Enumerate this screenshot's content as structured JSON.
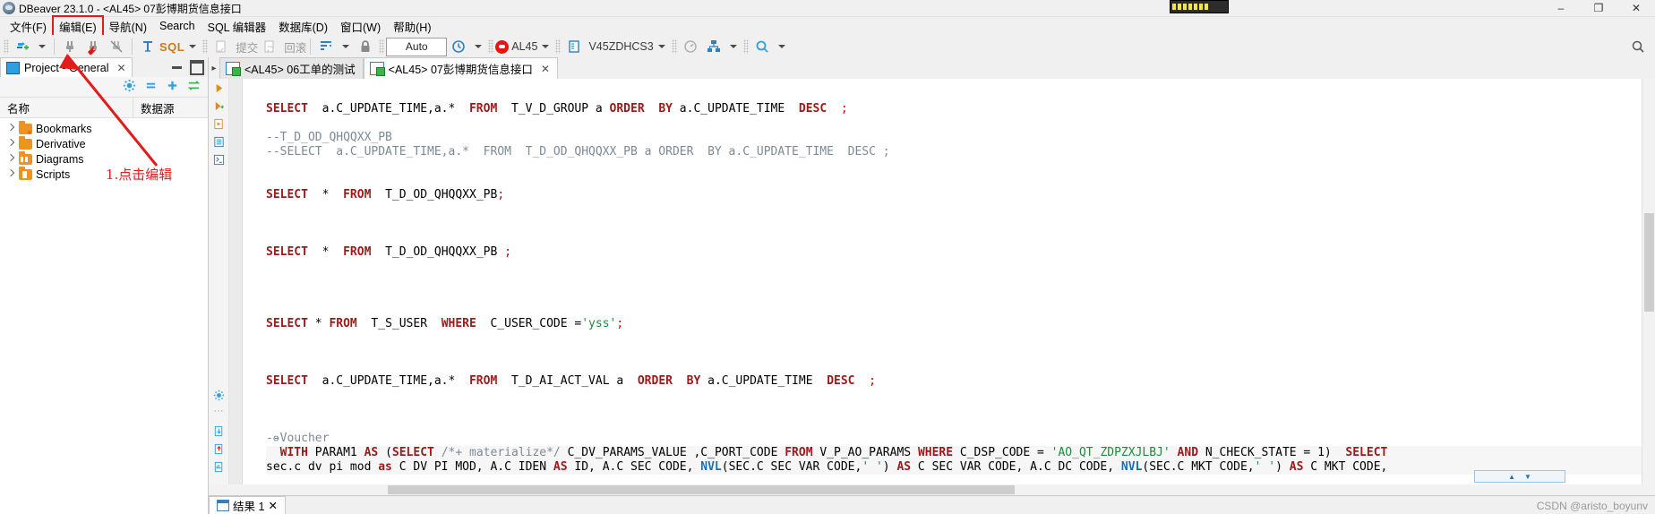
{
  "window": {
    "title": "DBeaver 23.1.0 - <AL45> 07彭博期货信息接口",
    "app_icon": "dbeaver-icon",
    "minimize": "–",
    "maximize": "❐",
    "close": "✕"
  },
  "menubar": {
    "items": [
      {
        "label": "文件(F)",
        "boxed": false
      },
      {
        "label": "编辑(E)",
        "boxed": true
      },
      {
        "label": "导航(N)",
        "boxed": false
      },
      {
        "label": "Search",
        "boxed": false
      },
      {
        "label": "SQL 编辑器",
        "boxed": false
      },
      {
        "label": "数据库(D)",
        "boxed": false
      },
      {
        "label": "窗口(W)",
        "boxed": false
      },
      {
        "label": "帮助(H)",
        "boxed": false
      }
    ]
  },
  "toolbar": {
    "new_connection": "new-connection-icon",
    "connect": "connect-icon",
    "disconnect": "disconnect-icon",
    "invalidate": "invalidate-icon",
    "sql_label": "SQL",
    "commit_label": "提交",
    "rollback_label": "回滚",
    "txn_mode_icon": "transaction-mode-icon",
    "lock_icon": "lock-icon",
    "auto_value": "Auto",
    "history_icon": "history-icon",
    "connection_name": "AL45",
    "database_name": "V45ZDHCS3",
    "dashboard_icon": "dashboard-icon",
    "schema_icon": "schema-icon",
    "search_icon": "search-icon",
    "global_search_icon": "global-search-icon"
  },
  "left_panel": {
    "tab_label": "Project - General",
    "tab_close": "✕",
    "tab_icon": "project-icon",
    "minimize_icon": "minimize-icon",
    "maximize_icon": "maximize-icon",
    "tools": [
      "gear-icon",
      "collapse-all-icon",
      "add-icon",
      "link-icon"
    ],
    "col_name": "名称",
    "col_datasource": "数据源",
    "tree": [
      {
        "label": "Bookmarks",
        "icon": "bookmark-folder-icon"
      },
      {
        "label": "Derivative",
        "icon": "folder-icon"
      },
      {
        "label": "Diagrams",
        "icon": "diagram-folder-icon"
      },
      {
        "label": "Scripts",
        "icon": "script-folder-icon"
      }
    ]
  },
  "annotation": {
    "text": "1.点击编辑",
    "color": "#e21b1b"
  },
  "editor": {
    "scroll_left_icon": "▸",
    "tabs": [
      {
        "label": "<AL45> 06工单的测试",
        "active": false,
        "close": "",
        "icon": "sql-file-icon"
      },
      {
        "label": "<AL45> 07彭博期货信息接口",
        "active": true,
        "close": "✕",
        "icon": "sql-file-icon"
      }
    ],
    "gutter_icons": [
      "execute-statement-icon",
      "execute-script-icon",
      "execute-to-file-icon",
      "execute-grid-icon",
      "execute-console-icon",
      "gear-icon",
      "more-icon",
      "export-icon",
      "import-icon",
      "report-icon"
    ],
    "fold_marker": "⊖",
    "lines": [
      {
        "blank": true
      },
      {
        "tokens": [
          {
            "t": "SELECT",
            "c": "kw"
          },
          {
            "t": "  a.C_UPDATE_TIME,a.*  ",
            "c": "plain"
          },
          {
            "t": "FROM",
            "c": "kw"
          },
          {
            "t": "  T_V_D_GROUP a ",
            "c": "plain"
          },
          {
            "t": "ORDER",
            "c": "kw"
          },
          {
            "t": "  ",
            "c": "plain"
          },
          {
            "t": "BY",
            "c": "kw"
          },
          {
            "t": " a.C_UPDATE_TIME  ",
            "c": "plain"
          },
          {
            "t": "DESC",
            "c": "kw"
          },
          {
            "t": "  ;",
            "c": "pun"
          }
        ]
      },
      {
        "blank": true
      },
      {
        "tokens": [
          {
            "t": "--T_D_OD_QHQQXX_PB",
            "c": "cm"
          }
        ]
      },
      {
        "tokens": [
          {
            "t": "--SELECT  a.C_UPDATE_TIME,a.*  FROM  T_D_OD_QHQQXX_PB a ORDER  BY a.C_UPDATE_TIME  DESC ;",
            "c": "cm"
          }
        ]
      },
      {
        "blank": true
      },
      {
        "blank": true
      },
      {
        "tokens": [
          {
            "t": "SELECT",
            "c": "kw"
          },
          {
            "t": "  *  ",
            "c": "plain"
          },
          {
            "t": "FROM",
            "c": "kw"
          },
          {
            "t": "  T_D_OD_QHQQXX_PB",
            "c": "plain"
          },
          {
            "t": ";",
            "c": "pun"
          }
        ]
      },
      {
        "blank": true
      },
      {
        "blank": true
      },
      {
        "blank": true
      },
      {
        "tokens": [
          {
            "t": "SELECT",
            "c": "kw"
          },
          {
            "t": "  *  ",
            "c": "plain"
          },
          {
            "t": "FROM",
            "c": "kw"
          },
          {
            "t": "  T_D_OD_QHQQXX_PB ",
            "c": "plain"
          },
          {
            "t": ";",
            "c": "pun"
          }
        ]
      },
      {
        "blank": true
      },
      {
        "blank": true
      },
      {
        "blank": true
      },
      {
        "blank": true
      },
      {
        "tokens": [
          {
            "t": "SELECT",
            "c": "kw"
          },
          {
            "t": " * ",
            "c": "plain"
          },
          {
            "t": "FROM",
            "c": "kw"
          },
          {
            "t": "  T_S_USER  ",
            "c": "plain"
          },
          {
            "t": "WHERE",
            "c": "kw"
          },
          {
            "t": "  C_USER_CODE =",
            "c": "plain"
          },
          {
            "t": "'yss'",
            "c": "str"
          },
          {
            "t": ";",
            "c": "pun"
          }
        ]
      },
      {
        "blank": true
      },
      {
        "blank": true
      },
      {
        "blank": true
      },
      {
        "tokens": [
          {
            "t": "SELECT",
            "c": "kw"
          },
          {
            "t": "  a.C_UPDATE_TIME,a.*  ",
            "c": "plain"
          },
          {
            "t": "FROM",
            "c": "kw"
          },
          {
            "t": "  T_D_AI_ACT_VAL a  ",
            "c": "plain"
          },
          {
            "t": "ORDER",
            "c": "kw"
          },
          {
            "t": "  ",
            "c": "plain"
          },
          {
            "t": "BY",
            "c": "kw"
          },
          {
            "t": " a.C_UPDATE_TIME  ",
            "c": "plain"
          },
          {
            "t": "DESC",
            "c": "kw"
          },
          {
            "t": "  ;",
            "c": "pun"
          }
        ]
      },
      {
        "blank": true
      },
      {
        "blank": true
      },
      {
        "blank": true
      },
      {
        "tokens": [
          {
            "t": "--Voucher",
            "c": "cm"
          }
        ],
        "fold": true
      },
      {
        "tokens": [
          {
            "t": "  WITH",
            "c": "kw"
          },
          {
            "t": " PARAM1 ",
            "c": "plain"
          },
          {
            "t": "AS",
            "c": "kw"
          },
          {
            "t": " (",
            "c": "plain"
          },
          {
            "t": "SELECT",
            "c": "kw"
          },
          {
            "t": " ",
            "c": "plain"
          },
          {
            "t": "/*+ materialize*/",
            "c": "cm"
          },
          {
            "t": " C_DV_PARAMS_VALUE ,C_PORT_CODE ",
            "c": "plain"
          },
          {
            "t": "FROM",
            "c": "kw"
          },
          {
            "t": " V_P_AO_PARAMS ",
            "c": "plain"
          },
          {
            "t": "WHERE",
            "c": "kw"
          },
          {
            "t": " C_DSP_CODE = ",
            "c": "plain"
          },
          {
            "t": "'AO_QT_ZDPZXJLBJ'",
            "c": "str"
          },
          {
            "t": " ",
            "c": "plain"
          },
          {
            "t": "AND",
            "c": "kw"
          },
          {
            "t": " N_CHECK_STATE = ",
            "c": "plain"
          },
          {
            "t": "1",
            "c": "plain"
          },
          {
            "t": ")  ",
            "c": "plain"
          },
          {
            "t": "SELECT",
            "c": "kw"
          }
        ],
        "highlight": true
      },
      {
        "tokens": [
          {
            "t": "sec.c dv pi mod ",
            "c": "plain"
          },
          {
            "t": "as",
            "c": "kw"
          },
          {
            "t": " C DV PI MOD, A.C IDEN ",
            "c": "plain"
          },
          {
            "t": "AS",
            "c": "kw"
          },
          {
            "t": " ID, A.C SEC CODE, ",
            "c": "plain"
          },
          {
            "t": "NVL",
            "c": "fn"
          },
          {
            "t": "(SEC.C SEC VAR CODE,",
            "c": "plain"
          },
          {
            "t": "' '",
            "c": "str"
          },
          {
            "t": ") ",
            "c": "plain"
          },
          {
            "t": "AS",
            "c": "kw"
          },
          {
            "t": " C SEC VAR CODE, A.C DC CODE, ",
            "c": "plain"
          },
          {
            "t": "NVL",
            "c": "fn"
          },
          {
            "t": "(SEC.C MKT CODE,",
            "c": "plain"
          },
          {
            "t": "' '",
            "c": "str"
          },
          {
            "t": ") ",
            "c": "plain"
          },
          {
            "t": "AS",
            "c": "kw"
          },
          {
            "t": " C MKT CODE,",
            "c": "plain"
          }
        ],
        "highlight": true
      }
    ],
    "mini_nav": {
      "up": "▲",
      "down": "▼"
    }
  },
  "results": {
    "tab_label": "结果 1",
    "tab_close": "✕",
    "tab_icon": "grid-icon"
  },
  "watermark": "CSDN @aristo_boyunv",
  "colors": {
    "accent_blue": "#2f7fc1",
    "keyword_red": "#9c1a1a",
    "string_green": "#1e8a3c",
    "comment_gray": "#7c8a96",
    "annotation_red": "#e21b1b",
    "folder_orange": "#f0931e"
  }
}
